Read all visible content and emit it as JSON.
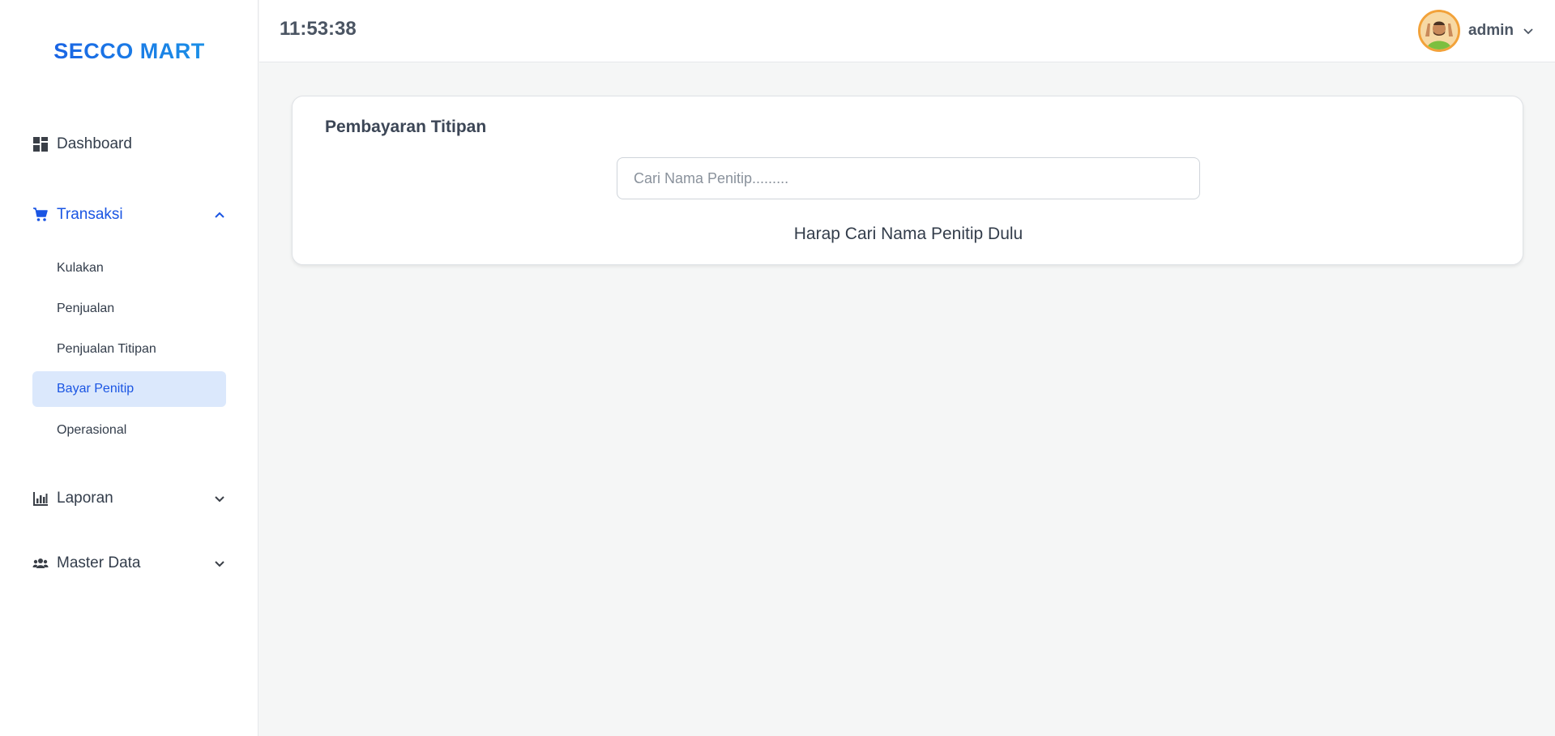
{
  "brand": "SECCO MART",
  "clock": "11:53:38",
  "user": {
    "name": "admin"
  },
  "sidebar": {
    "dashboard": "Dashboard",
    "transaksi": {
      "label": "Transaksi",
      "items": [
        "Kulakan",
        "Penjualan",
        "Penjualan Titipan",
        "Bayar Penitip",
        "Operasional"
      ],
      "active_item": "Bayar Penitip"
    },
    "laporan": "Laporan",
    "master_data": "Master Data"
  },
  "card": {
    "title": "Pembayaran Titipan",
    "search_placeholder": "Cari Nama Penitip.........",
    "hint": "Harap Cari Nama Penitip Dulu"
  },
  "colors": {
    "accent": "#1a55e3",
    "active_bg": "#dbe8fc",
    "text": "#333d4b",
    "background": "#f5f6f6"
  },
  "icons": {
    "dashboard": "grid-icon",
    "transaksi": "cart-icon",
    "laporan": "bar-chart-icon",
    "master_data": "users-icon"
  }
}
